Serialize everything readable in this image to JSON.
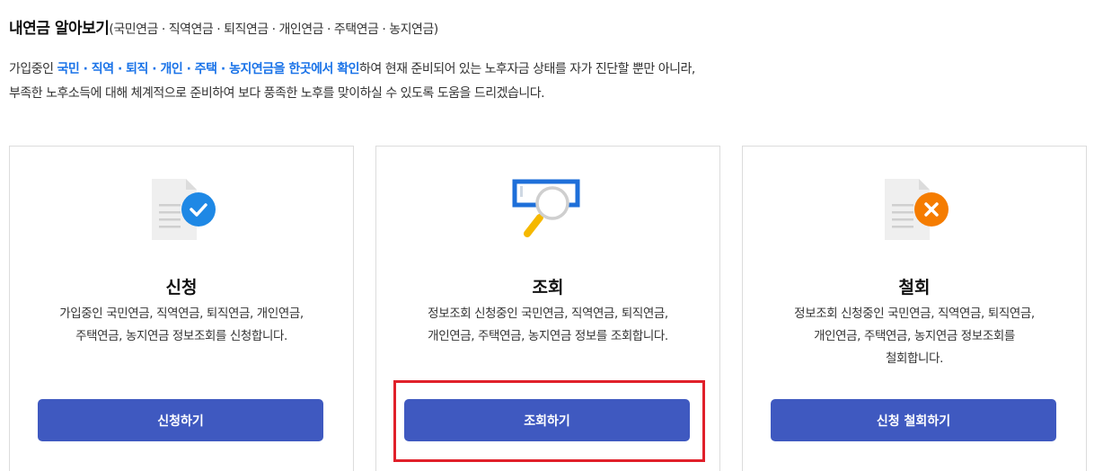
{
  "header": {
    "title": "내연금 알아보기",
    "subtitle": "(국민연금 · 직역연금 · 퇴직연금 · 개인연금 · 주택연금 · 농지연금)"
  },
  "intro": {
    "line1_prefix": "가입중인 ",
    "line1_highlight": "국민 · 직역 · 퇴직 · 개인 · 주택 · 농지연금을 한곳에서 확인",
    "line1_suffix": "하여 현재 준비되어 있는 노후자금 상태를 자가 진단할 뿐만 아니라,",
    "line2": "부족한 노후소득에 대해 체계적으로 준비하여 보다 풍족한 노후를 맞이하실 수 있도록 도움을 드리겠습니다."
  },
  "cards": [
    {
      "icon": "document-check-icon",
      "title": "신청",
      "text_line1": "가입중인 국민연금, 직역연금, 퇴직연금, 개인연금,",
      "text_line2": "주택연금, 농지연금 정보조회를 신청합니다.",
      "text_line3": "",
      "button": "신청하기"
    },
    {
      "icon": "search-magnifier-icon",
      "title": "조회",
      "text_line1": "정보조회 신청중인 국민연금, 직역연금, 퇴직연금,",
      "text_line2": "개인연금, 주택연금, 농지연금 정보를 조회합니다.",
      "text_line3": "",
      "button": "조회하기"
    },
    {
      "icon": "document-cancel-icon",
      "title": "철회",
      "text_line1": "정보조회 신청중인 국민연금, 직역연금, 퇴직연금,",
      "text_line2": "개인연금, 주택연금, 농지연금 정보조회를",
      "text_line3": "철회합니다.",
      "button": "신청 철회하기"
    }
  ],
  "colors": {
    "accent": "#3f59c0",
    "highlight_text": "#1a73e8",
    "check_badge": "#1e88e5",
    "cancel_badge": "#f57c00",
    "focus_box": "#e0202a"
  }
}
